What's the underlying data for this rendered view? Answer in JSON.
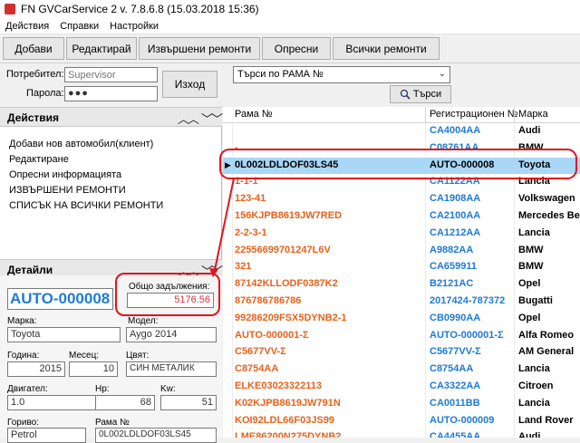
{
  "window": {
    "title": "FN GVCarService 2 v. 7.8.6.8 (15.03.2018 15:36)"
  },
  "menu": [
    "Действия",
    "Справки",
    "Настройки"
  ],
  "toolbar": {
    "add": "Добави",
    "edit": "Редактирай",
    "done_repairs": "Извършени ремонти",
    "refresh": "Опресни",
    "all_repairs": "Всички ремонти"
  },
  "login": {
    "user_label": "Потребител:",
    "user_placeholder": "Supervisor",
    "password_label": "Парола:",
    "password_value": "●●●",
    "exit_label": "Изход"
  },
  "search": {
    "mode": "Търси по РАМА №",
    "button_label": "Търси"
  },
  "actions": {
    "title": "Действия",
    "items": [
      "Добави нов автомобил(клиент)",
      "Редактиране",
      "Опресни информацията",
      "ИЗВЪРШЕНИ РЕМОНТИ",
      "СПИСЪК НА ВСИЧКИ РЕМОНТИ"
    ]
  },
  "details": {
    "title": "Детайли",
    "reg_number": "AUTO-000008",
    "debt_label": "Общо задължения:",
    "debt_value": "5176.56",
    "make_label": "Марка:",
    "make_value": "Toyota",
    "model_label": "Модел:",
    "model_value": "Aygo 2014",
    "year_label": "Година:",
    "year_value": "2015",
    "month_label": "Месец:",
    "month_value": "10",
    "color_label": "Цвят:",
    "color_value": "СИН МЕТАЛИК",
    "engine_label": "Двигател:",
    "engine_value": "1.0",
    "hp_label": "Hp:",
    "hp_value": "68",
    "kw_label": "Kw:",
    "kw_value": "51",
    "fuel_label": "Гориво:",
    "fuel_value": "Petrol",
    "frame_label": "Рама №",
    "frame_value": "0L002LDLDOF03LS45"
  },
  "grid": {
    "columns": [
      "Рама №",
      "Регистрационен №",
      "Марка"
    ],
    "rows": [
      {
        "frame": "",
        "reg": "CA4004AA",
        "make": "Audi"
      },
      {
        "frame": "-",
        "reg": "C08761AA",
        "make": "BMW"
      },
      {
        "frame": "0L002LDLDOF03LS45",
        "reg": "AUTO-000008",
        "make": "Toyota",
        "selected": true
      },
      {
        "frame": "1-1-1",
        "reg": "CA1122AA",
        "make": "Lancia"
      },
      {
        "frame": "123-41",
        "reg": "CA1908AA",
        "make": "Volkswagen"
      },
      {
        "frame": "156KJPB8619JW7RED",
        "reg": "CA2100AA",
        "make": "Mercedes Benz"
      },
      {
        "frame": "2-2-3-1",
        "reg": "CA1212AA",
        "make": "Lancia"
      },
      {
        "frame": "22556699701247L6V",
        "reg": "A9882AA",
        "make": "BMW"
      },
      {
        "frame": "321",
        "reg": "CA659911",
        "make": "BMW"
      },
      {
        "frame": "87142KLLODF0387K2",
        "reg": "B2121AC",
        "make": "Opel"
      },
      {
        "frame": "876786786786",
        "reg": "2017424-787372",
        "make": "Bugatti"
      },
      {
        "frame": "99286209FSX5DYNB2-1",
        "reg": "CB0990AA",
        "make": "Opel"
      },
      {
        "frame": "AUTO-000001-Σ",
        "reg": "AUTO-000001-Σ",
        "make": "Alfa Romeo"
      },
      {
        "frame": "C5677VV-Σ",
        "reg": "C5677VV-Σ",
        "make": "AM General"
      },
      {
        "frame": "C8754AA",
        "reg": "C8754AA",
        "make": "Lancia"
      },
      {
        "frame": "ELKE03023322113",
        "reg": "CA3322AA",
        "make": "Citroen"
      },
      {
        "frame": "K02KJPB8619JW791N",
        "reg": "CA0011BB",
        "make": "Lancia"
      },
      {
        "frame": "KOI92LDL66F03JS99",
        "reg": "AUTO-000009",
        "make": "Land Rover"
      },
      {
        "frame": "LME86200N275DYNB2",
        "reg": "CA4455AA",
        "make": "Audi"
      }
    ]
  },
  "colors": {
    "frame_text": "#e8611a",
    "reg_text": "#1e7bd4",
    "selection": "#a9d7f5",
    "annotation_red": "#e0141e"
  }
}
